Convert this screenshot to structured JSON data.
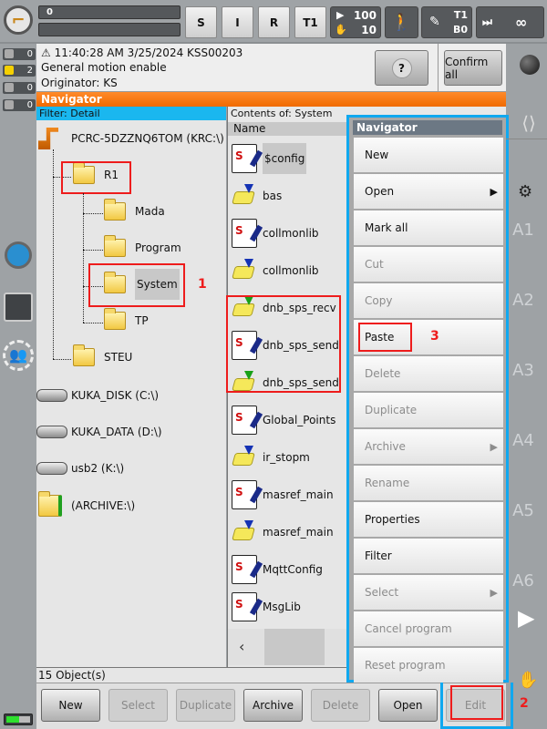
{
  "topbar": {
    "progress_value": "0",
    "mode_buttons": [
      "S",
      "I",
      "R",
      "T1"
    ],
    "override": {
      "prog": "100",
      "jog": "10"
    },
    "tool": {
      "t": "T1",
      "b": "B0"
    },
    "increment": "∞"
  },
  "status_counts": [
    {
      "type": "ack",
      "count": "0"
    },
    {
      "type": "warning",
      "count": "2"
    },
    {
      "type": "info",
      "count": "0"
    },
    {
      "type": "dialog",
      "count": "0"
    }
  ],
  "message": {
    "timestamp": "11:40:28 AM 3/25/2024 KSS00203",
    "text": "General motion enable",
    "originator": "Originator: KS",
    "help_label": "?",
    "confirm_label": "Confirm all"
  },
  "navigator": {
    "title": "Navigator",
    "filter": "Filter: Detail",
    "contents_of": "Contents of: System",
    "column_name": "Name"
  },
  "tree": {
    "root": "PCRC-5DZZNQ6TOM (KRC:\\)",
    "r1": "R1",
    "mada": "Mada",
    "program": "Program",
    "system": "System",
    "tp": "TP",
    "steu": "STEU",
    "kuka_disk": "KUKA_DISK (C:\\)",
    "kuka_data": "KUKA_DATA (D:\\)",
    "usb2": "usb2 (K:\\)",
    "archive": "(ARCHIVE:\\)"
  },
  "files": [
    {
      "name": "$config",
      "type": "src"
    },
    {
      "name": "bas",
      "type": "dat"
    },
    {
      "name": "collmonlib",
      "type": "src"
    },
    {
      "name": "collmonlib",
      "type": "dat"
    },
    {
      "name": "dnb_sps_recv",
      "type": "dat-green"
    },
    {
      "name": "dnb_sps_send",
      "type": "src"
    },
    {
      "name": "dnb_sps_send",
      "type": "dat-green"
    },
    {
      "name": "Global_Points",
      "type": "src"
    },
    {
      "name": "ir_stopm",
      "type": "dat"
    },
    {
      "name": "masref_main",
      "type": "src"
    },
    {
      "name": "masref_main",
      "type": "dat"
    },
    {
      "name": "MqttConfig",
      "type": "src"
    },
    {
      "name": "MsgLib",
      "type": "src"
    }
  ],
  "status_bar": "15 Object(s)",
  "bottom_buttons": {
    "new": "New",
    "select": "Select",
    "duplicate": "Duplicate",
    "archive": "Archive",
    "delete": "Delete",
    "open": "Open",
    "edit": "Edit"
  },
  "popup": {
    "title": "Navigator",
    "items": [
      {
        "label": "New",
        "enabled": true
      },
      {
        "label": "Open",
        "enabled": true,
        "submenu": true
      },
      {
        "label": "Mark all",
        "enabled": true
      },
      {
        "label": "Cut",
        "enabled": false
      },
      {
        "label": "Copy",
        "enabled": false
      },
      {
        "label": "Paste",
        "enabled": true
      },
      {
        "label": "Delete",
        "enabled": false
      },
      {
        "label": "Duplicate",
        "enabled": false
      },
      {
        "label": "Archive",
        "enabled": false,
        "submenu": true
      },
      {
        "label": "Rename",
        "enabled": false
      },
      {
        "label": "Properties",
        "enabled": true
      },
      {
        "label": "Filter",
        "enabled": true
      },
      {
        "label": "Select",
        "enabled": false,
        "submenu": true
      },
      {
        "label": "Cancel program",
        "enabled": false
      },
      {
        "label": "Reset program",
        "enabled": false
      }
    ],
    "submenu_arrow": "▶"
  },
  "annotations": {
    "step1": "1",
    "step2": "2",
    "step3": "3"
  },
  "axes": [
    "A1",
    "A2",
    "A3",
    "A4",
    "A5",
    "A6"
  ],
  "colors": {
    "accent_orange": "#f57a1a",
    "highlight_blue": "#10a8ef",
    "annotation_red": "#ee1c1c"
  }
}
